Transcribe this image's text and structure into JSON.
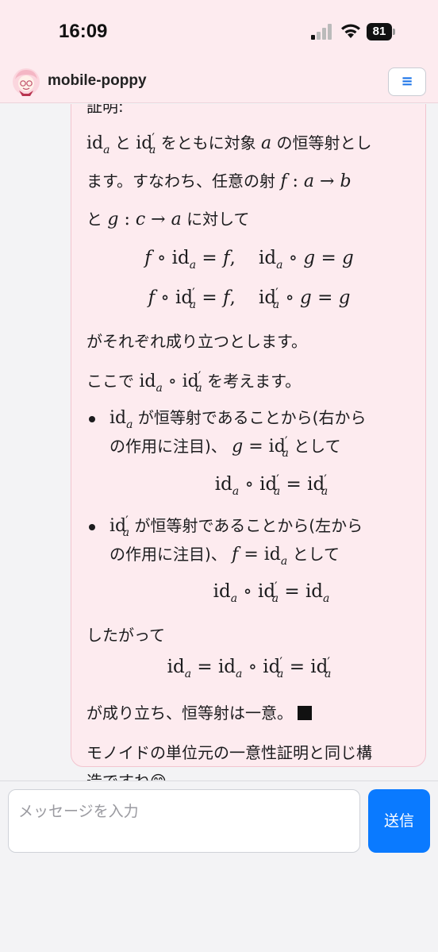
{
  "status_bar": {
    "time": "16:09",
    "battery": "81"
  },
  "header": {
    "title": "mobile-poppy",
    "menu_icon": "≡"
  },
  "message": {
    "heading_fragment": "証明:",
    "p1_a": "id",
    "p1_b": "と",
    "p1_c": "をともに対象",
    "p1_d": "の恒等射とし",
    "p2_a": "ます。すなわち、任意の射",
    "p3_a": "と",
    "p3_b": "に対して",
    "p4": "がそれぞれ成り立つとします。",
    "p5_a": "ここで",
    "p5_b": "を考えます。",
    "b1_a": "が恒等射であることから(右から",
    "b1_b": "の作用に注目)、",
    "b1_c": "として",
    "b2_a": "が恒等射であることから(左から",
    "b2_b": "の作用に注目)、",
    "b2_c": "として",
    "p6": "したがって",
    "p7": "が成り立ち、恒等射は一意。",
    "p8_a": "モノイドの単位元の一意性証明と同じ構",
    "p8_b": "造ですね😊"
  },
  "composer": {
    "placeholder": "メッセージを入力",
    "send_label": "送信"
  }
}
